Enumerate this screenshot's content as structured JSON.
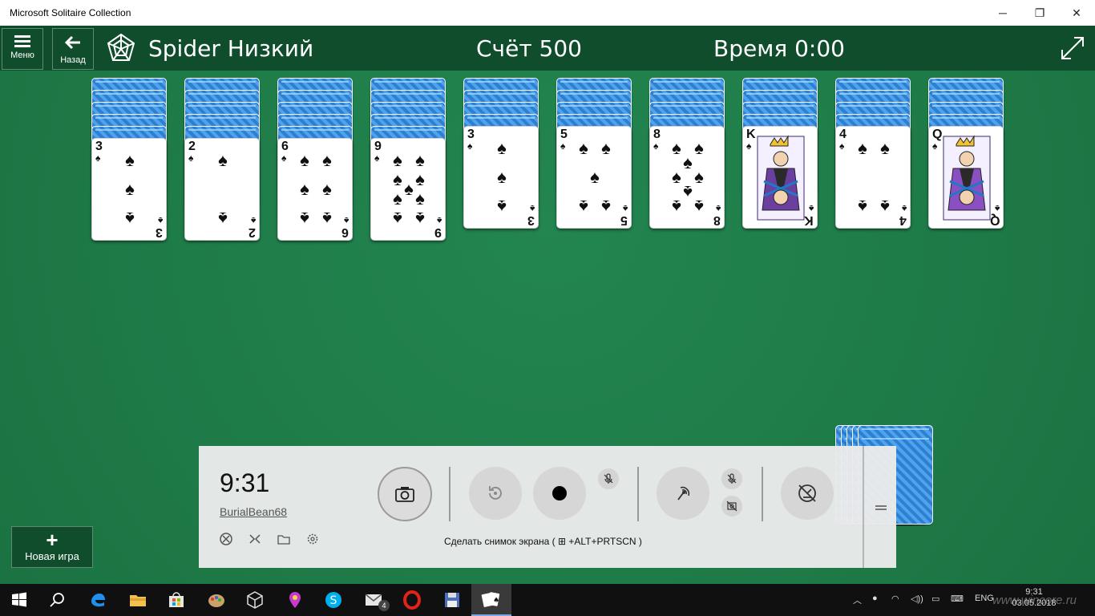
{
  "window": {
    "title": "Microsoft Solitaire Collection",
    "controls": [
      "─",
      "❐",
      "✕"
    ]
  },
  "header": {
    "menu_label": "Меню",
    "back_label": "Назад",
    "game_name": "Spider  Низкий",
    "score_text": "Счёт  500",
    "time_text": "Время  0:00"
  },
  "tableau": [
    {
      "face_down": 5,
      "rank": "3",
      "suit": "♠",
      "pip_count": 3
    },
    {
      "face_down": 5,
      "rank": "2",
      "suit": "♠",
      "pip_count": 2
    },
    {
      "face_down": 5,
      "rank": "6",
      "suit": "♠",
      "pip_count": 6
    },
    {
      "face_down": 5,
      "rank": "9",
      "suit": "♠",
      "pip_count": 9
    },
    {
      "face_down": 4,
      "rank": "3",
      "suit": "♠",
      "pip_count": 3
    },
    {
      "face_down": 4,
      "rank": "5",
      "suit": "♠",
      "pip_count": 5
    },
    {
      "face_down": 4,
      "rank": "8",
      "suit": "♠",
      "pip_count": 8
    },
    {
      "face_down": 4,
      "rank": "K",
      "suit": "♠",
      "pip_count": 0
    },
    {
      "face_down": 4,
      "rank": "4",
      "suit": "♠",
      "pip_count": 4
    },
    {
      "face_down": 4,
      "rank": "Q",
      "suit": "♠",
      "pip_count": 0
    }
  ],
  "stock": {
    "remaining_deals": 5
  },
  "new_game": {
    "label": "Новая игра"
  },
  "game_bar": {
    "clock": "9:31",
    "username": "BurialBean68",
    "caption": "Сделать снимок экрана ( ⊞ +ALT+PRTSCN )"
  },
  "taskbar": {
    "language": "ENG",
    "time": "9:31",
    "date": "03.05.2018",
    "mail_badge": "4",
    "watermark": "www.wincore.ru"
  },
  "colors": {
    "felt": "#1e7b48",
    "header": "#0f4d2c",
    "card_back": "#2f7fd0"
  }
}
